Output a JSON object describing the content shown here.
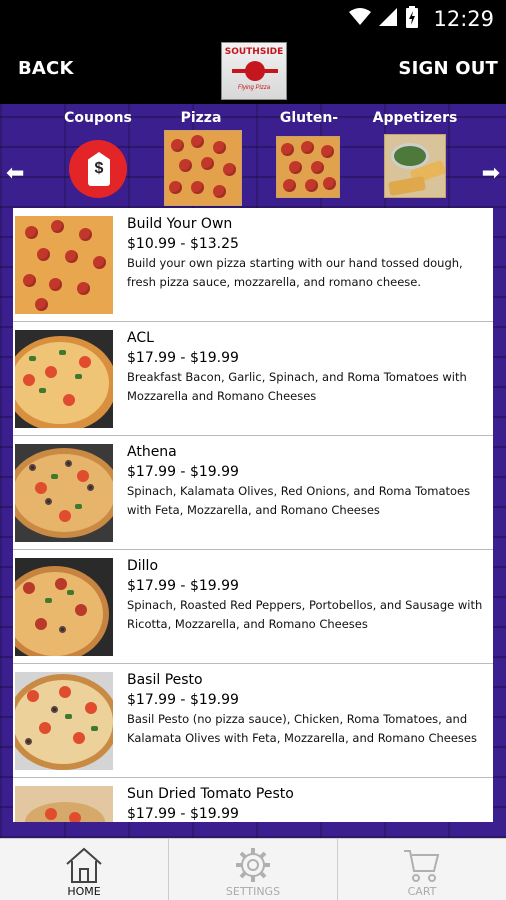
{
  "status_bar": {
    "time": "12:29",
    "icons": [
      "wifi-icon",
      "signal-icon",
      "battery-charging-icon"
    ]
  },
  "top_bar": {
    "back_label": "BACK",
    "sign_out_label": "SIGN OUT",
    "logo_text": "SOUTHSIDE",
    "logo_subtext": "Flying Pizza"
  },
  "categories": [
    {
      "label": "Coupons"
    },
    {
      "label": "Pizza"
    },
    {
      "label": "Gluten-Free"
    },
    {
      "label": "Appetizers"
    }
  ],
  "coupon_icon_symbol": "$",
  "menu_items": [
    {
      "name": "Build Your Own",
      "price": "$10.99 - $13.25",
      "description": "Build your own pizza starting with our hand tossed dough, fresh pizza sauce, mozzarella, and romano cheese."
    },
    {
      "name": "ACL",
      "price": "$17.99 - $19.99",
      "description": "Breakfast Bacon, Garlic, Spinach, and Roma Tomatoes with Mozzarella and Romano Cheeses"
    },
    {
      "name": "Athena",
      "price": "$17.99 - $19.99",
      "description": "Spinach, Kalamata Olives, Red Onions, and Roma Tomatoes with Feta, Mozzarella, and Romano Cheeses"
    },
    {
      "name": "Dillo",
      "price": "$17.99 - $19.99",
      "description": "Spinach, Roasted Red Peppers, Portobellos, and Sausage with Ricotta, Mozzarella, and Romano Cheeses"
    },
    {
      "name": "Basil Pesto",
      "price": "$17.99 - $19.99",
      "description": "Basil Pesto (no pizza sauce), Chicken, Roma Tomatoes, and Kalamata Olives with Feta, Mozzarella, and Romano Cheeses"
    },
    {
      "name": "Sun Dried Tomato Pesto",
      "price": "$17.99 - $19.99",
      "description": ""
    }
  ],
  "bottom_tabs": [
    {
      "label": "HOME",
      "icon": "home-icon"
    },
    {
      "label": "SETTINGS",
      "icon": "gear-icon"
    },
    {
      "label": "CART",
      "icon": "cart-icon"
    }
  ],
  "colors": {
    "brick_background": "#3b1f8e",
    "coupon_red": "#e32528",
    "pepperoni": "#c1372a"
  }
}
